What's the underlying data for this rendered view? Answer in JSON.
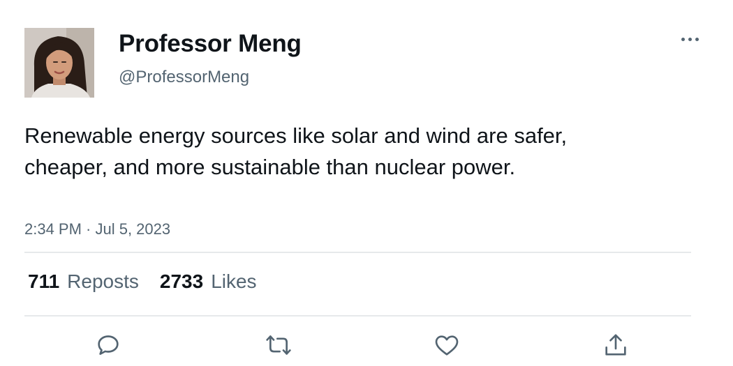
{
  "author": {
    "display_name": "Professor Meng",
    "handle": "@ProfessorMeng",
    "avatar": "profile-photo"
  },
  "post": {
    "text": "Renewable energy sources like solar and wind are safer, cheaper, and more sustainable than nuclear power.",
    "timestamp": "2:34 PM · Jul 5, 2023"
  },
  "stats": {
    "reposts_count": "711",
    "reposts_label": "Reposts",
    "likes_count": "2733",
    "likes_label": "Likes"
  },
  "actions": [
    {
      "icon": "reply-icon"
    },
    {
      "icon": "repost-icon"
    },
    {
      "icon": "like-icon"
    },
    {
      "icon": "share-icon"
    }
  ],
  "menu": {
    "icon": "more-options-icon"
  },
  "colors": {
    "text_primary": "#0f1419",
    "text_secondary": "#536471",
    "divider": "#e6e9eb",
    "icon": "#536471"
  }
}
